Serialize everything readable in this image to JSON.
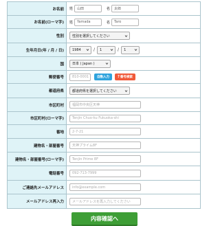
{
  "form": {
    "name": {
      "label": "お名前",
      "sei_label": "姓",
      "sei_value": "山田",
      "mei_label": "名",
      "mei_value": "太郎"
    },
    "name_roman": {
      "label": "お名前(ローマ字)",
      "sei_label": "姓",
      "sei_value": "Yamada",
      "mei_label": "名",
      "mei_value": "Taro"
    },
    "gender": {
      "label": "性別",
      "selected": "性別を選択してください"
    },
    "birthday": {
      "label": "生年月日(年 / 月 / 日)",
      "year": "1984",
      "month": "1",
      "day": "1",
      "sep": "/"
    },
    "country": {
      "label": "国",
      "selected": "日本 ( Japan )"
    },
    "postal": {
      "label": "郵便番号",
      "placeholder": "810-0001",
      "auto_button": "自動入力",
      "search_button": "番号検索",
      "search_mark": "?"
    },
    "prefecture": {
      "label": "都道府県",
      "selected": "都道府県を選択してください"
    },
    "city": {
      "label": "市区町村",
      "placeholder": "福岡市中央区天神"
    },
    "city_roman": {
      "label": "市区町村(ローマ字)",
      "placeholder": "Tenjin Chuo-ku Fukuoka-shi"
    },
    "street": {
      "label": "番地",
      "placeholder": "2-7-21"
    },
    "building": {
      "label": "建物名・部屋番号",
      "placeholder": "天神プライム8F"
    },
    "building_roman": {
      "label": "建物名・部屋番号(ローマ字)",
      "placeholder": "Tenjin Prime 8F"
    },
    "phone": {
      "label": "電話番号",
      "placeholder": "092-713-7999"
    },
    "email": {
      "label": "ご連絡先メールアドレス",
      "placeholder": "info@example.com"
    },
    "email_confirm": {
      "label": "メールアドレス再入力",
      "placeholder": "メールアドレスを再入力してください"
    }
  },
  "submit_label": "内容確認へ",
  "colors": {
    "label_bg": "#dff3f7",
    "border": "#aac4cc",
    "submit": "#3e9e36",
    "auto_btn": "#2ea3dd",
    "search_btn": "#f05a3a"
  }
}
